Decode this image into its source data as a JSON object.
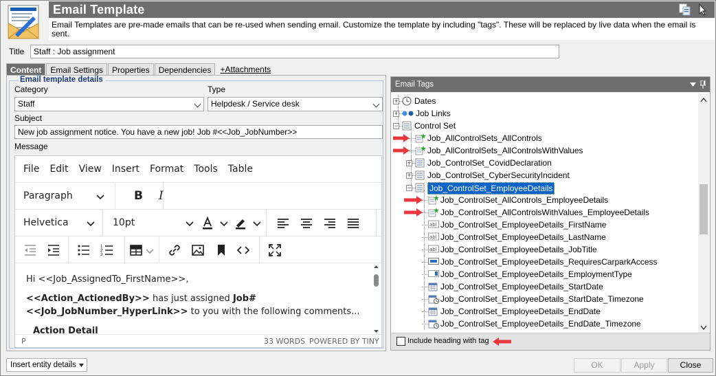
{
  "header": {
    "title": "Email Template",
    "description": "Email Templates are pre-made emails that can be re-used when sending email.  Customize the template by including \"tags\".  These will be replaced by live data when the email is sent."
  },
  "form": {
    "title_label": "Title",
    "title_value": "Staff : Job assignment"
  },
  "tabs": [
    {
      "label": "Content",
      "active": true
    },
    {
      "label": "Email Settings"
    },
    {
      "label": "Properties"
    },
    {
      "label": "Dependencies"
    },
    {
      "label": "+Attachments",
      "link": true
    }
  ],
  "details": {
    "legend": "Email template details",
    "category_label": "Category",
    "category_value": "Staff",
    "type_label": "Type",
    "type_value": "Helpdesk / Service desk",
    "subject_label": "Subject",
    "subject_value": "New job assignment notice.  You have a new job!  Job #<<Job_JobNumber>>",
    "message_label": "Message"
  },
  "editor": {
    "menu": [
      "File",
      "Edit",
      "View",
      "Insert",
      "Format",
      "Tools",
      "Table"
    ],
    "block_format": "Paragraph",
    "font_family": "Helvetica",
    "font_size": "10pt",
    "content": {
      "line1": "Hi <<Job_AssignedTo_FirstName>>,",
      "bold1": "<<Action_ActionedBy>>",
      "text1": " has just assigned ",
      "bold2": "Job#",
      "bold3": "<<Job_JobNumber_HyperLink>>",
      "text2": " to you with the following comments...",
      "partial": "Action Detail"
    },
    "status_path": "P",
    "word_count": "33 WORDS",
    "powered_by": "POWERED BY TINY"
  },
  "tags_panel": {
    "title": "Email Tags",
    "include_heading_label": "Include heading with tag",
    "include_heading_checked": false,
    "tree": [
      {
        "label": "Dates",
        "icon": "clock-icon",
        "toggle": "+"
      },
      {
        "label": "Job Links",
        "icon": "link-icon",
        "toggle": "+"
      },
      {
        "label": "Control Set",
        "icon": "form-icon",
        "toggle": "-"
      },
      {
        "label": "Job_AllControlSets_AllControls",
        "icon": "tag-star-icon",
        "arrow": true
      },
      {
        "label": "Job_AllControlSets_AllControlsWithValues",
        "icon": "tag-star-icon",
        "arrow": true
      },
      {
        "label": "Job_ControlSet_CovidDeclaration",
        "icon": "form-icon",
        "toggle": "+"
      },
      {
        "label": "Job_ControlSet_CyberSecurityIncident",
        "icon": "form-icon",
        "toggle": "+"
      },
      {
        "label": "Job_ControlSet_EmployeeDetails",
        "icon": "form-icon",
        "toggle": "-",
        "selected": true
      },
      {
        "label": "Job_ControlSet_AllControls_EmployeeDetails",
        "icon": "tag-star-icon",
        "arrow": true
      },
      {
        "label": "Job_ControlSet_AllControlsWithValues_EmployeeDetails",
        "icon": "tag-star-icon",
        "arrow": true
      },
      {
        "label": "Job_ControlSet_EmployeeDetails_FirstName",
        "icon": "text-field-icon"
      },
      {
        "label": "Job_ControlSet_EmployeeDetails_LastName",
        "icon": "text-field-icon"
      },
      {
        "label": "Job_ControlSet_EmployeeDetails_JobTitle",
        "icon": "text-field-icon"
      },
      {
        "label": "Job_ControlSet_EmployeeDetails_RequiresCarparkAccess",
        "icon": "toggle-field-icon"
      },
      {
        "label": "Job_ControlSet_EmployeeDetails_EmploymentType",
        "icon": "dropdown-field-icon"
      },
      {
        "label": "Job_ControlSet_EmployeeDetails_StartDate",
        "icon": "calendar-icon"
      },
      {
        "label": "Job_ControlSet_EmployeeDetails_StartDate_Timezone",
        "icon": "calendar-clock-icon"
      },
      {
        "label": "Job_ControlSet_EmployeeDetails_EndDate",
        "icon": "calendar-icon"
      },
      {
        "label": "Job_ControlSet_EmployeeDetails_EndDate_Timezone",
        "icon": "calendar-clock-icon"
      }
    ]
  },
  "footer": {
    "insert_entity_label": "Insert entity details",
    "ok_label": "OK",
    "apply_label": "Apply",
    "close_label": "Close"
  },
  "colors": {
    "header_bar": "#6e6e6e",
    "selection": "#0a64c8",
    "arrow": "#e8383d"
  }
}
